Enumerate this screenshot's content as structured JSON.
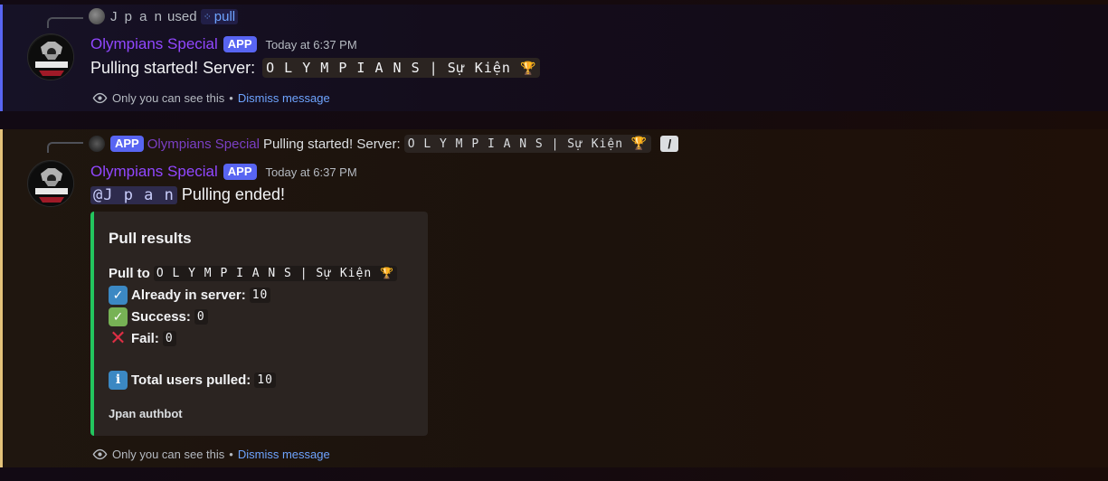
{
  "message1": {
    "reply": {
      "user": "J p a n",
      "used_label": "used",
      "command": "pull"
    },
    "author": "Olympians Special",
    "badge": "APP",
    "timestamp": "Today at 6:37 PM",
    "content_text": "Pulling started! Server:",
    "server_name": "O L Y M P I A N S | Sự Kiện",
    "ephemeral": {
      "notice": "Only you can see this",
      "separator": "•",
      "dismiss": "Dismiss message"
    }
  },
  "message2": {
    "reply": {
      "badge": "APP",
      "author": "Olympians Special",
      "text": "Pulling started! Server:",
      "server_name": "O L Y M P I A N S | Sự Kiện"
    },
    "author": "Olympians Special",
    "badge": "APP",
    "timestamp": "Today at 6:37 PM",
    "mention": "@J p a n",
    "content_text": "Pulling ended!",
    "embed": {
      "title": "Pull results",
      "pull_to_label": "Pull to",
      "server_name": "O L Y M P I A N S | Sự Kiện",
      "already_label": "Already in server:",
      "already_value": "10",
      "success_label": "Success:",
      "success_value": "0",
      "fail_label": "Fail:",
      "fail_value": "0",
      "total_label": "Total users pulled:",
      "total_value": "10",
      "footer": "Jpan authbot",
      "accent_color": "#23c55e"
    },
    "ephemeral": {
      "notice": "Only you can see this",
      "separator": "•",
      "dismiss": "Dismiss message"
    }
  },
  "icons": {
    "server_trophy": "trophy-icon",
    "eye": "eye-icon",
    "command": "slash-command-icon",
    "info": "information-icon"
  },
  "colors": {
    "username": "#9147ff",
    "app_badge": "#5865f2",
    "link": "#6ea4ff",
    "msg1_border": "#5865f2",
    "msg2_border": "#e3c27a"
  }
}
